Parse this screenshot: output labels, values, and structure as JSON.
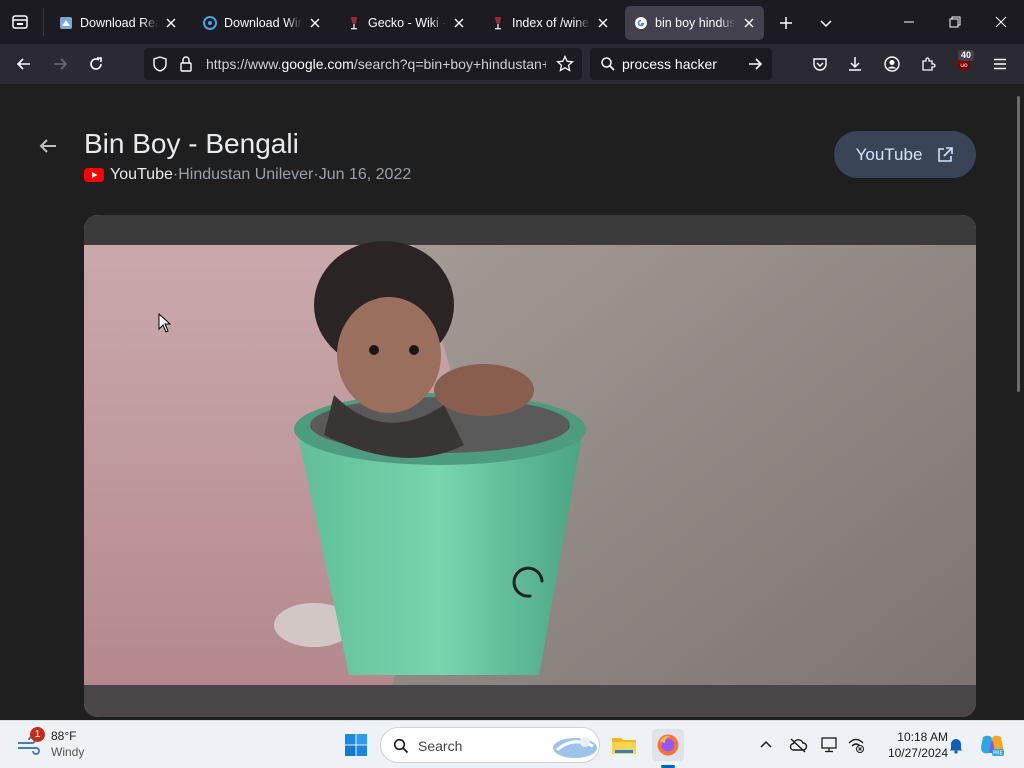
{
  "browser": {
    "tabs": [
      {
        "title": "Download ReactOS",
        "favicon": "reactos-icon",
        "active": false
      },
      {
        "title": "Download WineHQ",
        "favicon": "winehq-icon",
        "active": false
      },
      {
        "title": "Gecko - Wiki - wine",
        "favicon": "wine-icon",
        "active": false
      },
      {
        "title": "Index of /wine/wine",
        "favicon": "wine-icon",
        "active": false
      },
      {
        "title": "bin boy hindustan",
        "favicon": "google-icon",
        "active": true
      }
    ],
    "url": {
      "prefix": "https://www.",
      "domain": "google.com",
      "rest": "/search?q=bin+boy+hindustan+unilever"
    },
    "search_value": "process hacker",
    "extension_badge": "40"
  },
  "page": {
    "title": "Bin Boy - Bengali",
    "source": "YouTube",
    "separator": " · ",
    "channel": "Hindustan Unilever",
    "date": "Jun 16, 2022",
    "open_button_label": "YouTube"
  },
  "taskbar": {
    "weather_temp": "88°F",
    "weather_cond": "Windy",
    "weather_badge": "1",
    "search_label": "Search",
    "time": "10:18 AM",
    "date": "10/27/2024"
  }
}
